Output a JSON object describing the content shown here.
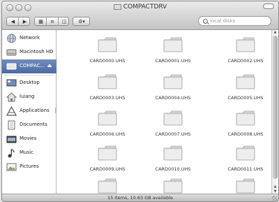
{
  "window": {
    "title": "COMPACTDRV"
  },
  "toolbar": {
    "back_icon": "back-arrow-icon",
    "forward_icon": "forward-arrow-icon",
    "view_modes": [
      "icon-view",
      "list-view",
      "column-view"
    ],
    "action_icon": "gear-icon",
    "search_placeholder": "local disks"
  },
  "sidebar": {
    "devices": [
      {
        "label": "Network",
        "icon": "network-globe-icon"
      },
      {
        "label": "Macintosh HD",
        "icon": "hard-disk-icon"
      },
      {
        "label": "COMPAC...",
        "icon": "removable-disk-icon",
        "selected": true,
        "eject_icon": "eject-icon"
      }
    ],
    "places": [
      {
        "label": "Desktop",
        "icon": "desktop-icon"
      },
      {
        "label": "luiang",
        "icon": "home-icon"
      },
      {
        "label": "Applications",
        "icon": "applications-icon"
      },
      {
        "label": "Documents",
        "icon": "documents-icon"
      },
      {
        "label": "Movies",
        "icon": "movies-icon"
      },
      {
        "label": "Music",
        "icon": "music-icon"
      },
      {
        "label": "Pictures",
        "icon": "pictures-icon"
      }
    ]
  },
  "files": [
    "CARD0000.UHS",
    "CARD0001.UHS",
    "CARD0002.UHS",
    "CARD0003.UHS",
    "CARD0004.UHS",
    "CARD0005.UHS",
    "CARD0006.UHS",
    "CARD0007.UHS",
    "CARD0008.UHS",
    "CARD0009.UHS",
    "CARD0010.UHS",
    "CARD0011.UHS",
    "",
    "",
    ""
  ],
  "status": {
    "text": "15 items, 10.63 GB available"
  }
}
